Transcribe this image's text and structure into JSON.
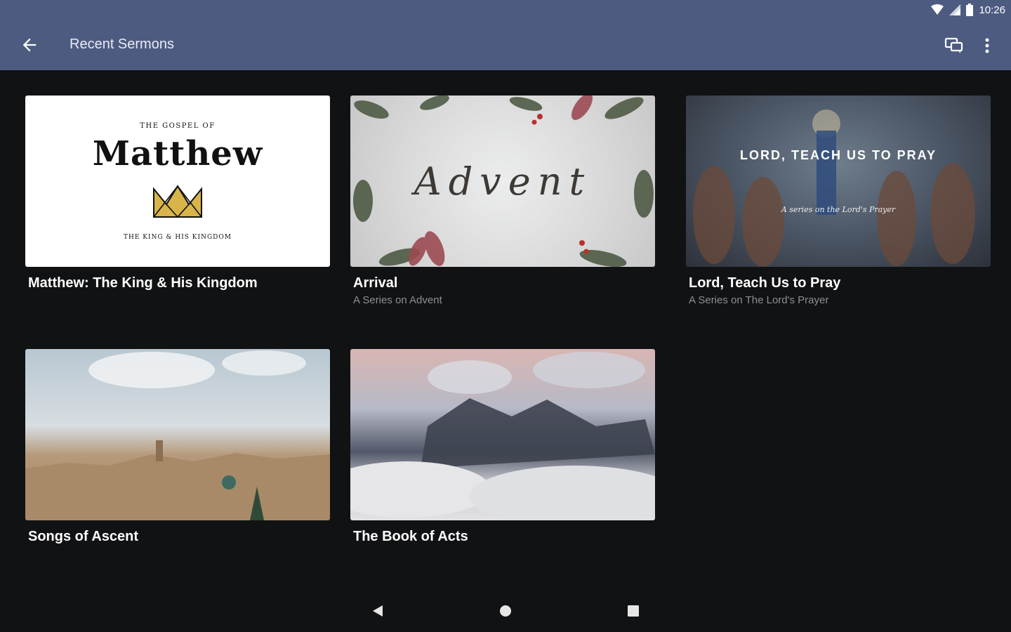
{
  "status_bar": {
    "time": "10:26",
    "icons": [
      "wifi-icon",
      "signal-icon",
      "battery-icon"
    ]
  },
  "app_bar": {
    "title": "Recent Sermons",
    "back_icon": "arrow-left-icon",
    "actions": [
      "chat-icon",
      "more-vert-icon"
    ]
  },
  "sermons": [
    {
      "title": "Matthew: The King & His Kingdom",
      "subtitle": "",
      "art": {
        "kicker": "THE GOSPEL OF",
        "big": "Matthew",
        "foot": "THE KING & HIS KINGDOM"
      }
    },
    {
      "title": "Arrival",
      "subtitle": "A Series on Advent",
      "art": {
        "big": "Advent"
      }
    },
    {
      "title": "Lord, Teach Us to Pray",
      "subtitle": "A Series on The Lord's Prayer",
      "art": {
        "big": "LORD, TEACH US TO PRAY",
        "script": "A series on the Lord's Prayer"
      }
    },
    {
      "title": "Songs of Ascent",
      "subtitle": ""
    },
    {
      "title": "The Book of Acts",
      "subtitle": ""
    }
  ],
  "nav_bar": {
    "icons": [
      "back-triangle-icon",
      "home-circle-icon",
      "recents-square-icon"
    ]
  },
  "colors": {
    "app_bar": "#4d5b80",
    "background": "#111214",
    "title_text": "#ffffff",
    "subtitle_text": "#8d8f94"
  }
}
